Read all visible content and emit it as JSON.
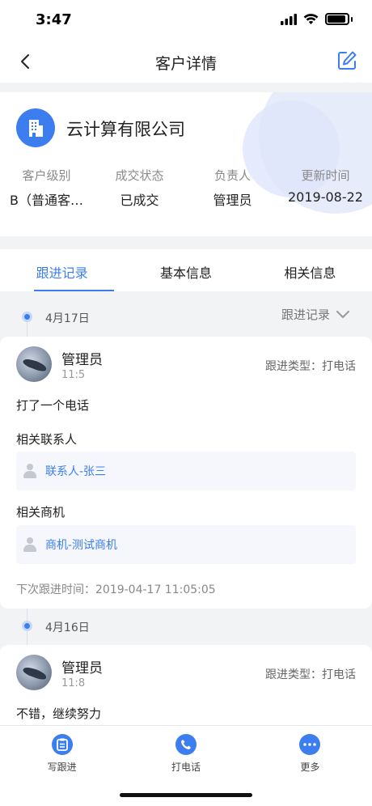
{
  "status_bar": {
    "time": "3:47"
  },
  "nav": {
    "title": "客户详情"
  },
  "customer": {
    "name": "云计算有限公司",
    "info": [
      {
        "label": "客户级别",
        "value": "B（普通客…"
      },
      {
        "label": "成交状态",
        "value": "已成交"
      },
      {
        "label": "负责人",
        "value": "管理员"
      },
      {
        "label": "更新时间",
        "value": "2019-08-22"
      }
    ]
  },
  "tabs": [
    "跟进记录",
    "基本信息",
    "相关信息"
  ],
  "filter": {
    "label": "跟进记录"
  },
  "records": [
    {
      "date": "4月17日",
      "name": "管理员",
      "time": "11:5",
      "type": "跟进类型：打电话",
      "content": "打了一个电话",
      "contact_label": "相关联系人",
      "contact": "联系人-张三",
      "opportunity_label": "相关商机",
      "opportunity": "商机-测试商机",
      "next_time": "下次跟进时间：2019-04-17 11:05:05"
    },
    {
      "date": "4月16日",
      "name": "管理员",
      "time": "11:8",
      "type": "跟进类型：打电话",
      "content": "不错，继续努力"
    }
  ],
  "bottom": [
    "写跟进",
    "打电话",
    "更多"
  ],
  "colors": {
    "accent": "#3c7ef0",
    "background": "#f2f3f5"
  }
}
